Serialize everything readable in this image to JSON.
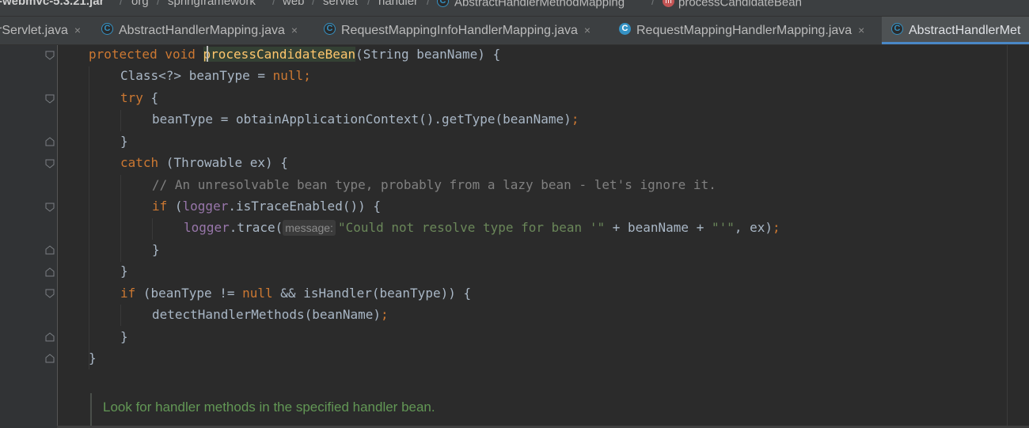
{
  "breadcrumb": {
    "items": [
      "-webmvc-5.3.21.jar",
      "org",
      "springframework",
      "web",
      "servlet",
      "handler",
      "AbstractHandlerMethodMapping",
      "processCandidateBean"
    ]
  },
  "tabs": [
    {
      "label": "rServlet.java"
    },
    {
      "label": "AbstractHandlerMapping.java"
    },
    {
      "label": "RequestMappingInfoHandlerMapping.java"
    },
    {
      "label": "RequestMappingHandlerMapping.java"
    },
    {
      "label": "AbstractHandlerMet"
    }
  ],
  "icons": {
    "class": "C",
    "method": "m",
    "close": "×"
  },
  "code": {
    "l1": {
      "a": "protected",
      "b": " ",
      "c": "void",
      "d": " ",
      "e": "processCandidateBean",
      "f": "(String beanName) {"
    },
    "l2": {
      "a": "Class<?> beanType = ",
      "b": "null",
      "c": ";"
    },
    "l3": {
      "a": "try",
      "b": " {"
    },
    "l4": {
      "a": "beanType = obtainApplicationContext().getType(beanName)",
      "b": ";"
    },
    "l5": {
      "a": "}"
    },
    "l6": {
      "a": "catch",
      "b": " (Throwable ex) {"
    },
    "l7": {
      "a": "// An unresolvable bean type, probably from a lazy bean - let's ignore it."
    },
    "l8": {
      "a": "if",
      "b": " (",
      "c": "logger",
      "d": ".isTraceEnabled()) {"
    },
    "l9": {
      "a": "logger",
      "b": ".trace(",
      "hint": "message:",
      "c": "\"Could not resolve type for bean '\"",
      "d": " + beanName + ",
      "e": "\"'\"",
      "f": ", ex)",
      "g": ";"
    },
    "l10": {
      "a": "}"
    },
    "l11": {
      "a": "}"
    },
    "l12": {
      "a": "if",
      "b": " (beanType != ",
      "c": "null",
      "d": " && isHandler(beanType)) {"
    },
    "l13": {
      "a": "detectHandlerMethods(beanName)",
      "b": ";"
    },
    "l14": {
      "a": "}"
    },
    "l15": {
      "a": "}"
    }
  },
  "javadoc": {
    "text": "Look for handler methods in the specified handler bean."
  },
  "colors": {
    "keyword": "#cc7832",
    "method_decl": "#ffc66d",
    "string": "#6a8759",
    "comment": "#808080",
    "field": "#9876aa",
    "javadoc": "#629755",
    "tab_underline": "#4a88c7"
  }
}
